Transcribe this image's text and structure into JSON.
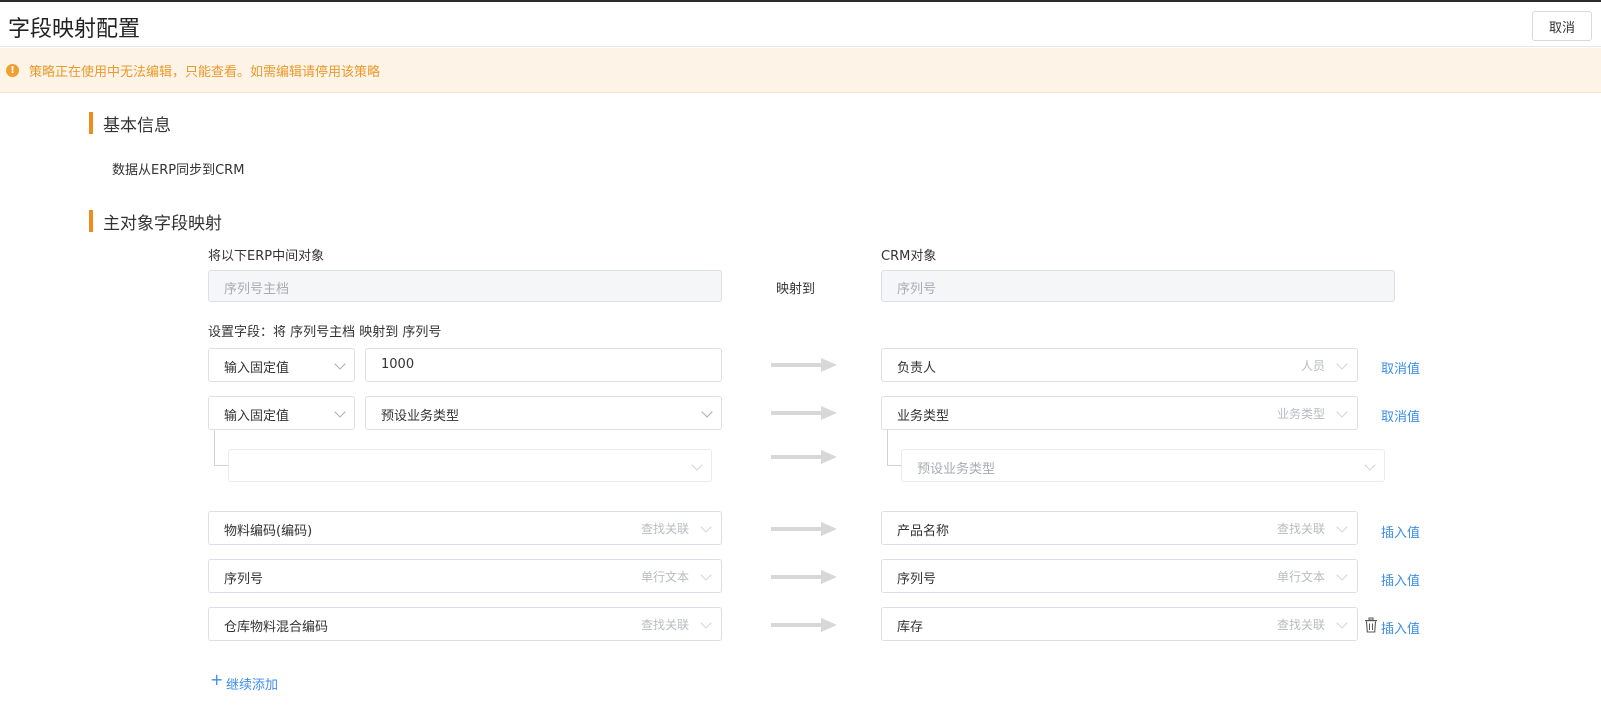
{
  "header": {
    "title": "字段映射配置",
    "cancel_label": "取消"
  },
  "warning": {
    "text": "策略正在使用中无法编辑，只能查看。如需编辑请停用该策略"
  },
  "basic_info": {
    "title": "基本信息",
    "description": "数据从ERP同步到CRM"
  },
  "mapping": {
    "title": "主对象字段映射",
    "source_label": "将以下ERP中间对象",
    "source_object": "序列号主档",
    "maps_to": "映射到",
    "target_label": "CRM对象",
    "target_object": "序列号",
    "settings_label": "设置字段：将 序列号主档 映射到 序列号",
    "rows": [
      {
        "mode": "输入固定值",
        "source": "1000",
        "target": "负责人",
        "target_type": "人员",
        "action": "取消值"
      },
      {
        "mode": "输入固定值",
        "source": "预设业务类型",
        "target": "业务类型",
        "target_type": "业务类型",
        "action": "取消值"
      },
      {
        "source": "",
        "target": "预设业务类型"
      },
      {
        "source": "物料编码(编码)",
        "source_type": "查找关联",
        "target": "产品名称",
        "target_type": "查找关联",
        "action": "插入值"
      },
      {
        "source": "序列号",
        "source_type": "单行文本",
        "target": "序列号",
        "target_type": "单行文本",
        "action": "插入值"
      },
      {
        "source": "仓库物料混合编码",
        "source_type": "查找关联",
        "target": "库存",
        "target_type": "查找关联",
        "action": "插入值"
      }
    ],
    "add_more": "继续添加"
  },
  "icons": {
    "warning": "exclamation-circle-icon",
    "chevron": "chevron-down-icon",
    "arrow": "arrow-right-icon",
    "delete": "trash-icon",
    "add": "plus-icon"
  },
  "colors": {
    "accent": "#f08c1e",
    "link": "#3c8ee8",
    "warning_bg": "#fdf3e7",
    "warning_text": "#e89a2c"
  }
}
